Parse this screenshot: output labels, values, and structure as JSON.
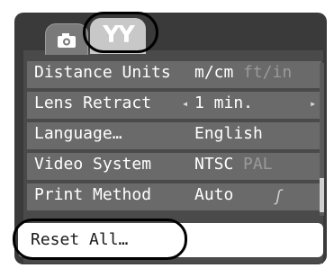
{
  "tabs": {
    "camera": {
      "icon": "camera-icon"
    },
    "setup": {
      "label": "ΥΥ",
      "icon": "tools-icon"
    }
  },
  "menu": {
    "rows": [
      {
        "label": "Distance Units",
        "value": "m/cm",
        "alt": "ft/in"
      },
      {
        "label": "Lens Retract",
        "value": "1 min.",
        "left_arrow": "◂",
        "right_arrow": "▸"
      },
      {
        "label": "Language…",
        "value": "English"
      },
      {
        "label": "Video System",
        "value": "NTSC",
        "alt": "PAL"
      },
      {
        "label": "Print Method",
        "value": "Auto",
        "icon": "direct-print-icon",
        "icon_glyph": "ʃ"
      }
    ],
    "selected": {
      "label": "Reset All…"
    }
  },
  "colors": {
    "background": "#3a3a3a",
    "row": "#6a6a6a",
    "selected_row": "#ffffff",
    "text": "#ffffff",
    "inactive_text": "#9a9a9a"
  }
}
